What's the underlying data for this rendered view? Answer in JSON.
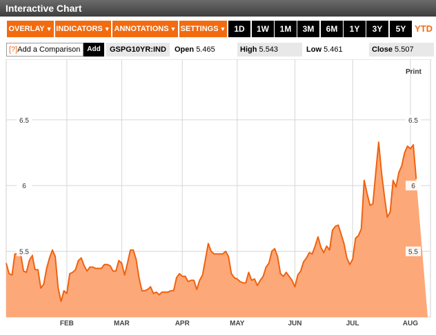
{
  "title": "Interactive Chart",
  "menus": [
    {
      "label": "OVERLAY"
    },
    {
      "label": "INDICATORS"
    },
    {
      "label": "ANNOTATIONS"
    },
    {
      "label": "SETTINGS"
    }
  ],
  "ranges": [
    "1D",
    "1W",
    "1M",
    "3M",
    "6M",
    "1Y",
    "3Y",
    "5Y",
    "YTD"
  ],
  "active_range": "YTD",
  "comparison": {
    "help": "[?]",
    "label": "Add a Comparison",
    "button": "Add"
  },
  "symbol": "GSPG10YR:IND",
  "stats": {
    "open_label": "Open",
    "open": "5.465",
    "high_label": "High",
    "high": "5.543",
    "low_label": "Low",
    "low": "5.461",
    "close_label": "Close",
    "close": "5.507"
  },
  "print_label": "Print",
  "colors": {
    "accent": "#f26b0f",
    "area": "#fda878",
    "line": "#ee6210"
  },
  "chart_data": {
    "type": "area",
    "ylim": [
      5.0,
      6.95
    ],
    "yticks": [
      5.5,
      6,
      6.5
    ],
    "ytick_labels": [
      "5.5",
      "6",
      "6.5"
    ],
    "months": [
      "FEB",
      "MAR",
      "APR",
      "MAY",
      "JUN",
      "JUL",
      "AUG"
    ],
    "month_pos": [
      21,
      40,
      61,
      80,
      100,
      120,
      140
    ],
    "x": [
      0,
      1,
      2,
      3,
      4,
      5,
      6,
      7,
      8,
      9,
      10,
      11,
      12,
      13,
      14,
      15,
      16,
      17,
      18,
      19,
      20,
      21,
      22,
      23,
      24,
      25,
      26,
      27,
      28,
      29,
      30,
      31,
      32,
      33,
      34,
      35,
      36,
      37,
      38,
      39,
      40,
      41,
      42,
      43,
      44,
      45,
      46,
      47,
      48,
      49,
      50,
      51,
      52,
      53,
      54,
      55,
      56,
      57,
      58,
      59,
      60,
      61,
      62,
      63,
      64,
      65,
      66,
      67,
      68,
      69,
      70,
      71,
      72,
      73,
      74,
      75,
      76,
      77,
      78,
      79,
      80,
      81,
      82,
      83,
      84,
      85,
      86,
      87,
      88,
      89,
      90,
      91,
      92,
      93,
      94,
      95,
      96,
      97,
      98,
      99,
      100,
      101,
      102,
      103,
      104,
      105,
      106,
      107,
      108,
      109,
      110,
      111,
      112,
      113,
      114,
      115,
      116,
      117,
      118,
      119,
      120,
      121,
      122,
      123,
      124,
      125,
      126,
      127,
      128,
      129,
      130,
      131,
      132,
      133,
      134,
      135,
      136,
      137,
      138,
      139,
      140,
      141,
      142,
      143,
      144,
      145,
      146
    ],
    "values": [
      5.41,
      5.33,
      5.32,
      5.48,
      5.48,
      5.48,
      5.35,
      5.34,
      5.43,
      5.47,
      5.36,
      5.36,
      5.22,
      5.25,
      5.37,
      5.45,
      5.51,
      5.46,
      5.22,
      5.12,
      5.2,
      5.18,
      5.33,
      5.34,
      5.36,
      5.43,
      5.45,
      5.39,
      5.35,
      5.38,
      5.38,
      5.37,
      5.37,
      5.37,
      5.4,
      5.4,
      5.39,
      5.35,
      5.35,
      5.43,
      5.41,
      5.32,
      5.41,
      5.51,
      5.51,
      5.44,
      5.3,
      5.2,
      5.2,
      5.21,
      5.23,
      5.18,
      5.19,
      5.17,
      5.19,
      5.19,
      5.19,
      5.2,
      5.2,
      5.3,
      5.33,
      5.31,
      5.31,
      5.27,
      5.28,
      5.28,
      5.21,
      5.28,
      5.32,
      5.44,
      5.56,
      5.5,
      5.48,
      5.48,
      5.48,
      5.48,
      5.5,
      5.46,
      5.33,
      5.3,
      5.29,
      5.27,
      5.26,
      5.26,
      5.34,
      5.28,
      5.29,
      5.24,
      5.28,
      5.31,
      5.38,
      5.41,
      5.5,
      5.52,
      5.46,
      5.33,
      5.31,
      5.34,
      5.31,
      5.28,
      5.23,
      5.32,
      5.35,
      5.42,
      5.45,
      5.49,
      5.48,
      5.54,
      5.61,
      5.53,
      5.49,
      5.54,
      5.51,
      5.66,
      5.69,
      5.7,
      5.63,
      5.56,
      5.45,
      5.4,
      5.44,
      5.6,
      5.62,
      5.67,
      6.04,
      5.94,
      5.85,
      5.86,
      6.1,
      6.33,
      6.1,
      5.92,
      5.76,
      5.8,
      6.04,
      5.99,
      6.1,
      6.15,
      6.25,
      6.3,
      6.28,
      6.31,
      6.05
    ],
    "xlim": [
      0,
      146
    ]
  }
}
